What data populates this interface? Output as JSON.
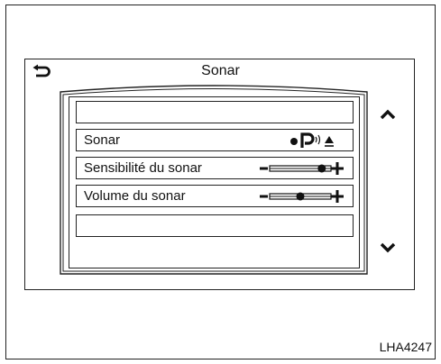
{
  "header": {
    "title": "Sonar",
    "back_icon": "back-arrow-icon"
  },
  "menu": {
    "items": [
      {
        "label": "",
        "control": "none"
      },
      {
        "label": "Sonar",
        "control": "sonar-status-icons"
      },
      {
        "label": "Sensibilité du sonar",
        "control": "level-slider",
        "level_fraction": 0.85
      },
      {
        "label": "Volume du sonar",
        "control": "level-slider",
        "level_fraction": 0.5
      },
      {
        "label": "",
        "control": "none"
      }
    ],
    "scroll_up_icon": "chevron-up-icon",
    "scroll_down_icon": "chevron-down-icon"
  },
  "reference": "LHA4247"
}
